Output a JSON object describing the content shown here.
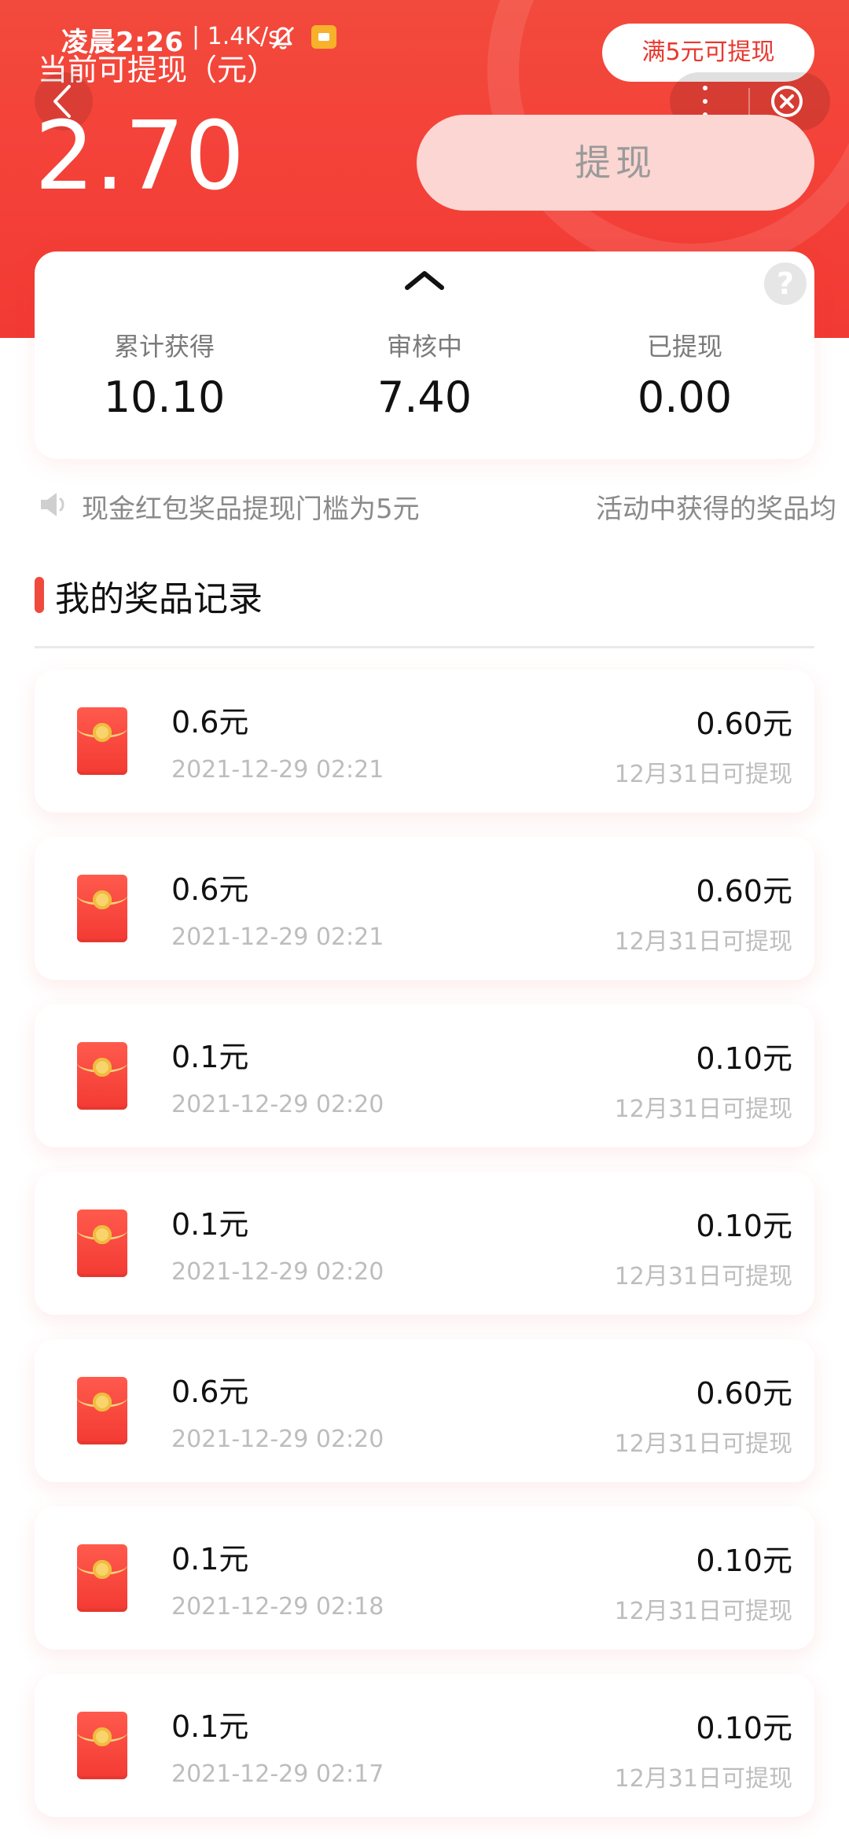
{
  "status_bar": {
    "time": "凌晨2:26",
    "network_speed": "| 1.4K/s"
  },
  "header": {
    "balance_label": "当前可提现（元）",
    "balance_value": "2.70",
    "threshold_badge": "满5元可提现",
    "withdraw_button": "提现"
  },
  "summary": {
    "items": [
      {
        "label": "累计获得",
        "value": "10.10"
      },
      {
        "label": "审核中",
        "value": "7.40"
      },
      {
        "label": "已提现",
        "value": "0.00"
      }
    ],
    "help_label": "?"
  },
  "notice": {
    "texts": [
      "现金红包奖品提现门槛为5元",
      "活动中获得的奖品均"
    ]
  },
  "section": {
    "title": "我的奖品记录"
  },
  "records": [
    {
      "title": "0.6元",
      "time": "2021-12-29 02:21",
      "amount": "0.60元",
      "available": "12月31日可提现"
    },
    {
      "title": "0.6元",
      "time": "2021-12-29 02:21",
      "amount": "0.60元",
      "available": "12月31日可提现"
    },
    {
      "title": "0.1元",
      "time": "2021-12-29 02:20",
      "amount": "0.10元",
      "available": "12月31日可提现"
    },
    {
      "title": "0.1元",
      "time": "2021-12-29 02:20",
      "amount": "0.10元",
      "available": "12月31日可提现"
    },
    {
      "title": "0.6元",
      "time": "2021-12-29 02:20",
      "amount": "0.60元",
      "available": "12月31日可提现"
    },
    {
      "title": "0.1元",
      "time": "2021-12-29 02:18",
      "amount": "0.10元",
      "available": "12月31日可提现"
    },
    {
      "title": "0.1元",
      "time": "2021-12-29 02:17",
      "amount": "0.10元",
      "available": "12月31日可提现"
    }
  ],
  "colors": {
    "accent": "#f24a3c",
    "withdraw_button_bg": "#fbd6d2",
    "muted_text": "#bdbdbd"
  },
  "icons": {
    "back": "chevron-left-icon",
    "more": "more-vertical-icon",
    "close": "close-circle-icon",
    "collapse": "chevron-up-icon",
    "help": "question-circle-icon",
    "speaker": "speaker-icon",
    "record": "red-envelope-icon",
    "mute": "bell-off-icon",
    "message": "message-icon"
  }
}
